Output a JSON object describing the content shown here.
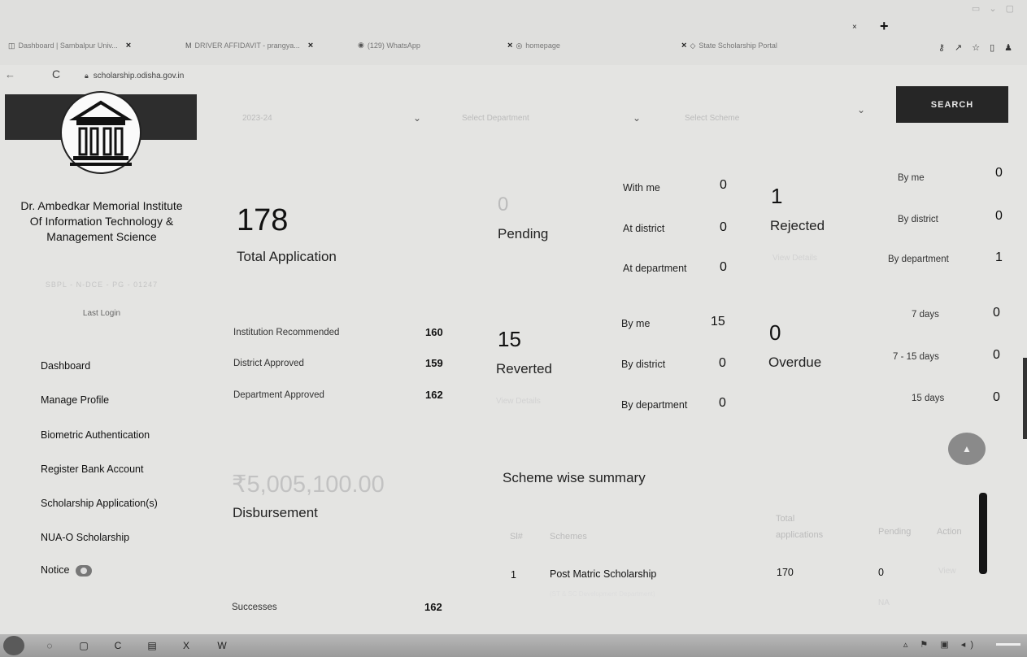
{
  "browser": {
    "tabs": [
      {
        "title": "Dashboard | Sambalpur Univ...",
        "icon": "page-icon"
      },
      {
        "title": "DRIVER AFFIDAVIT - prangya...",
        "icon": "gmail-icon"
      },
      {
        "title": "(129) WhatsApp",
        "icon": "whatsapp-icon"
      },
      {
        "title": "homepage",
        "icon": "globe-icon"
      },
      {
        "title": "State Scholarship Portal",
        "icon": "page-icon"
      }
    ],
    "new_tab": "+",
    "url": "scholarship.odisha.gov.in"
  },
  "sidebar": {
    "institution_name": "Dr. Ambedkar Memorial Institute Of Information Technology & Management Science",
    "institution_code": "SBPL - N-DCE - PG - 01247",
    "last_login": "Last Login",
    "menu": [
      {
        "label": "Dashboard"
      },
      {
        "label": "Manage Profile"
      },
      {
        "label": "Biometric Authentication"
      },
      {
        "label": "Register Bank Account"
      },
      {
        "label": "Scholarship Application(s)"
      },
      {
        "label": "NUA-O Scholarship"
      },
      {
        "label": "Notice"
      }
    ]
  },
  "filters": {
    "year": "2023-24",
    "department": "Select Department",
    "scheme": "Select Scheme",
    "search_label": "SEARCH"
  },
  "stats": {
    "total_application": {
      "value": "178",
      "label": "Total Application"
    },
    "institution_recommended": {
      "label": "Institution Recommended",
      "value": "160"
    },
    "district_approved": {
      "label": "District Approved",
      "value": "159"
    },
    "department_approved": {
      "label": "Department Approved",
      "value": "162"
    },
    "pending": {
      "value": "0",
      "label": "Pending",
      "with_me": {
        "label": "With me",
        "value": "0"
      },
      "at_district": {
        "label": "At district",
        "value": "0"
      },
      "at_department": {
        "label": "At department",
        "value": "0"
      }
    },
    "rejected": {
      "value": "1",
      "label": "Rejected",
      "view_details": "View Details",
      "by_me": {
        "label": "By me",
        "value": "0"
      },
      "by_district": {
        "label": "By district",
        "value": "0"
      },
      "by_department": {
        "label": "By department",
        "value": "1"
      }
    },
    "reverted": {
      "value": "15",
      "label": "Reverted",
      "view_details": "View Details",
      "by_me": {
        "label": "By me",
        "value": "15"
      },
      "by_district": {
        "label": "By district",
        "value": "0"
      },
      "by_department": {
        "label": "By department",
        "value": "0"
      }
    },
    "overdue": {
      "value": "0",
      "label": "Overdue",
      "d7": {
        "label": "7 days",
        "value": "0"
      },
      "d7_15": {
        "label": "7 - 15 days",
        "value": "0"
      },
      "d15": {
        "label": "15 days",
        "value": "0"
      }
    },
    "disbursement": {
      "amount": "₹5,005,100.00",
      "label": "Disbursement"
    },
    "successes": {
      "label": "Successes",
      "value": "162"
    }
  },
  "scheme_summary": {
    "title": "Scheme wise summary",
    "headers": {
      "sl": "Sl#",
      "scheme": "Schemes",
      "total": "Total applications",
      "pending": "Pending",
      "action": "Action"
    },
    "rows": [
      {
        "sl": "1",
        "scheme": "Post Matric Scholarship",
        "department": "(ST & SC Development Department)",
        "total": "170",
        "pending": "0",
        "action": "View",
        "action_sub": "NA"
      }
    ]
  }
}
